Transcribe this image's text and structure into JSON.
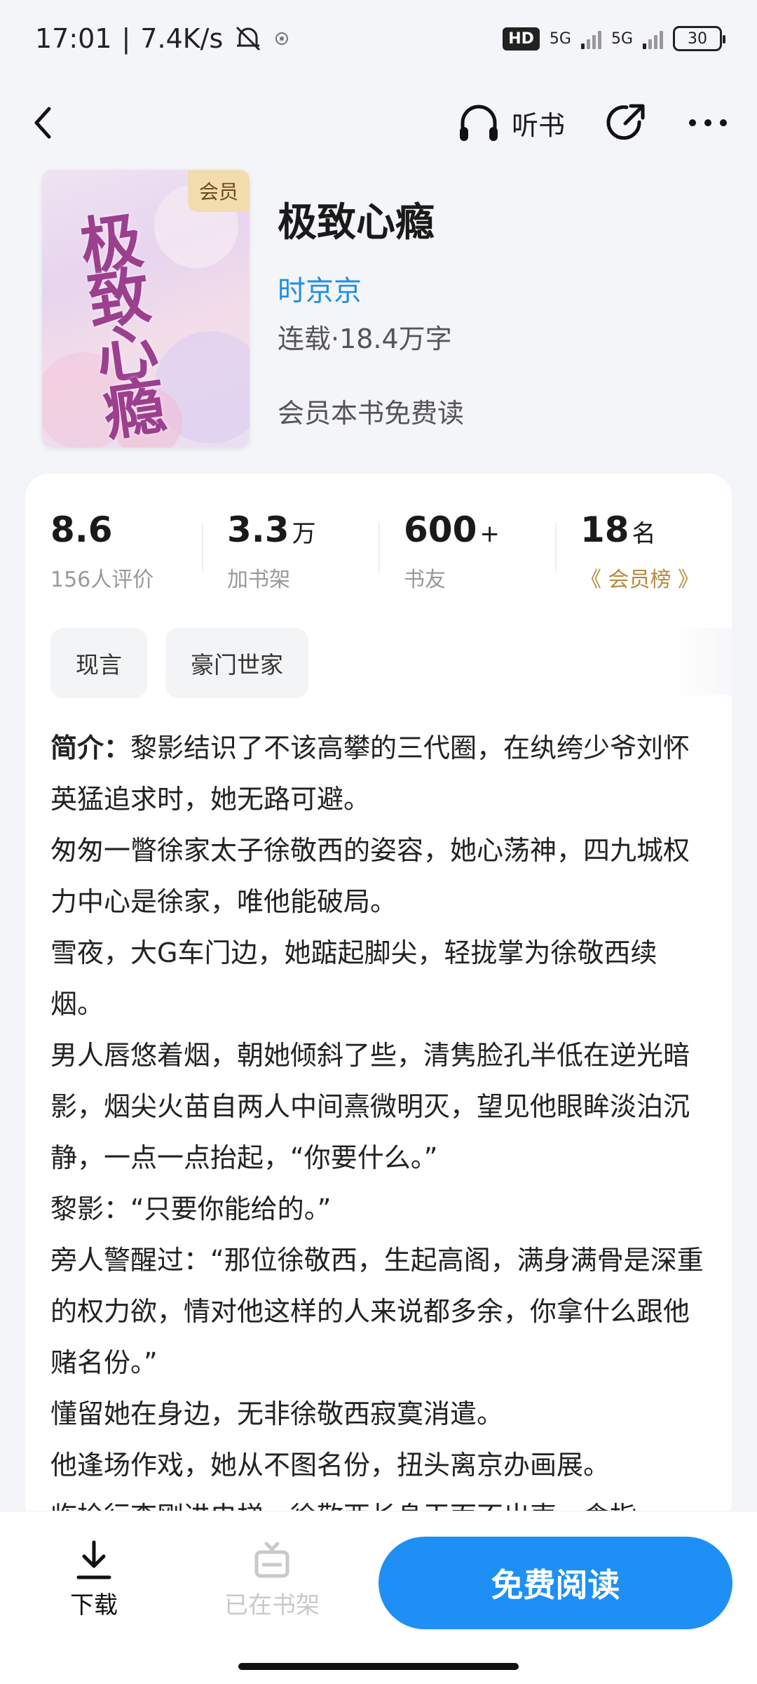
{
  "status_bar": {
    "time": "17:01",
    "network_speed": "7.4K/s",
    "hd": "HD",
    "signal1": "5G",
    "signal2": "5G",
    "battery": "30"
  },
  "header": {
    "listen_label": "听书"
  },
  "book": {
    "cover_badge": "会员",
    "cover_title": "极致心瘾",
    "title": "极致心瘾",
    "author": "时京京",
    "meta": "连载·18.4万字",
    "vip_note": "会员本书免费读"
  },
  "stats": [
    {
      "value": "8.6",
      "unit": "",
      "label": "156人评价"
    },
    {
      "value": "3.3",
      "unit": "万",
      "label": "加书架"
    },
    {
      "value": "600",
      "unit": "+",
      "label": "书友"
    },
    {
      "value": "18",
      "unit": "名",
      "label": "《 会员榜 》"
    }
  ],
  "tags": [
    "现言",
    "豪门世家"
  ],
  "intro": {
    "label": "简介：",
    "paragraphs": [
      "黎影结识了不该高攀的三代圈，在纨绔少爷刘怀英猛追求时，她无路可避。",
      "匆匆一瞥徐家太子徐敬西的姿容，她心荡神，四九城权力中心是徐家，唯他能破局。",
      "雪夜，大G车门边，她踮起脚尖，轻拢掌为徐敬西续烟。",
      "男人唇悠着烟，朝她倾斜了些，清隽脸孔半低在逆光暗影，烟尖火苗自两人中间熹微明灭，望见他眼眸淡泊沉静，一点一点抬起，“你要什么。”",
      "黎影：“只要你能给的。”",
      "旁人警醒过：“那位徐敬西，生起高阁，满身满骨是深重的权力欲，情对他这样的人来说都多余，你拿什么跟他赌名份。”",
      "懂留她在身边，无非徐敬西寂寞消遣。",
      "他逢场作戏，她从不图名份，扭头离京办画展。",
      "临检行李刚进电梯，徐敬西长身玉面不出声，食指"
    ]
  },
  "bottom": {
    "download": "下载",
    "on_shelf": "已在书架",
    "read": "免费阅读"
  }
}
